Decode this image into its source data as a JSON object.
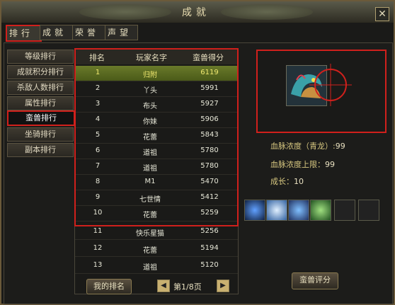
{
  "window": {
    "title": "成就",
    "close_label": "✕"
  },
  "tabs": [
    {
      "label": "排行"
    },
    {
      "label": "成就"
    },
    {
      "label": "荣誉"
    },
    {
      "label": "声望"
    }
  ],
  "sidebar": {
    "items": [
      {
        "label": "等级排行"
      },
      {
        "label": "成就积分排行"
      },
      {
        "label": "杀敌人数排行"
      },
      {
        "label": "属性排行"
      },
      {
        "label": "蛮兽排行"
      },
      {
        "label": "坐骑排行"
      },
      {
        "label": "副本排行"
      }
    ]
  },
  "table": {
    "headers": [
      "排名",
      "玩家名字",
      "蛮兽得分"
    ],
    "rows": [
      {
        "rank": "1",
        "name": "归附",
        "score": "6119"
      },
      {
        "rank": "2",
        "name": "丫头",
        "score": "5991"
      },
      {
        "rank": "3",
        "name": "布头",
        "score": "5927"
      },
      {
        "rank": "4",
        "name": "你妹",
        "score": "5906"
      },
      {
        "rank": "5",
        "name": "花蕾",
        "score": "5843"
      },
      {
        "rank": "6",
        "name": "道祖",
        "score": "5780"
      },
      {
        "rank": "7",
        "name": "道祖",
        "score": "5780"
      },
      {
        "rank": "8",
        "name": "M1",
        "score": "5470"
      },
      {
        "rank": "9",
        "name": "七世情",
        "score": "5412"
      },
      {
        "rank": "10",
        "name": "花蕾",
        "score": "5259"
      },
      {
        "rank": "11",
        "name": "快乐星猫",
        "score": "5256"
      },
      {
        "rank": "12",
        "name": "花蕾",
        "score": "5194"
      },
      {
        "rank": "13",
        "name": "道祖",
        "score": "5120"
      }
    ]
  },
  "footer": {
    "my_rank_label": "我的排名",
    "page_text": "第1/8页",
    "prev_icon": "◀",
    "next_icon": "▶"
  },
  "beast": {
    "purity_label": "血脉浓度（青龙）:",
    "purity_value": "99",
    "purity_max_label": "血脉浓度上限：",
    "purity_max_value": "99",
    "growth_label": "成长：",
    "growth_value": "10",
    "score_button_label": "蛮兽评分"
  },
  "colors": {
    "highlight": "#d0201c",
    "selected_row": "#5a6a22",
    "stat_label": "#d8c880"
  }
}
